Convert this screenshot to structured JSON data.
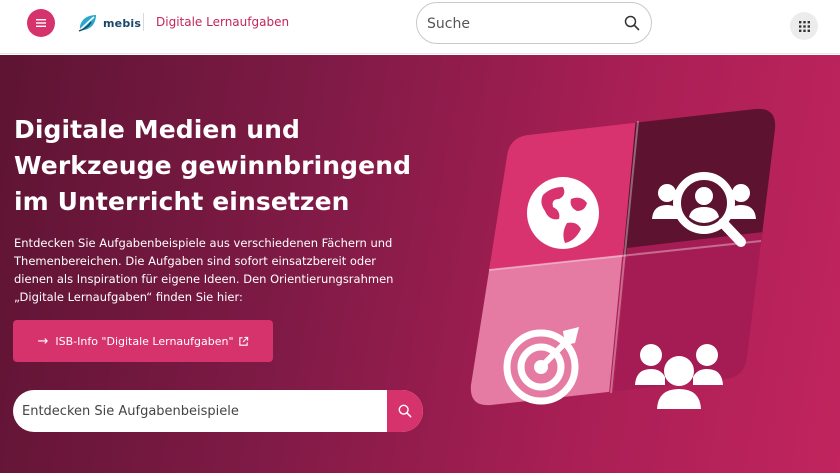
{
  "header": {
    "menu_icon": "hamburger-icon",
    "logo_text": "mebis",
    "app_title": "Digitale Lernaufgaben",
    "search": {
      "placeholder": "Suche",
      "icon": "search-icon"
    },
    "apps_icon": "grid-apps-icon"
  },
  "hero": {
    "title": "Digitale Medien und Werkzeuge gewinnbringend im Unterricht einsetzen",
    "description": "Entdecken Sie Aufgabenbeispiele aus verschiedenen Fächern und Themenbereichen. Die Aufgaben sind sofort einsatzbereit oder dienen als Inspiration für eigene Ideen. Den Orientierungsrahmen „Digitale Lernaufgaben“ finden Sie hier:",
    "isb_button": {
      "arrow": "→",
      "label": "ISB-Info \"Digitale Lernaufgaben\"",
      "icon": "external-link-icon"
    },
    "search": {
      "placeholder": "Entdecken Sie Aufgabenbeispiele",
      "icon": "search-icon"
    },
    "illustration_icons": [
      "globe-icon",
      "user-search-icon",
      "target-icon",
      "group-icon"
    ]
  },
  "colors": {
    "accent": "#d6336c",
    "title_accent": "#c2255c",
    "hero_dark": "#5e1433",
    "hero_light": "#c1245e",
    "logo_blue": "#19456b"
  }
}
